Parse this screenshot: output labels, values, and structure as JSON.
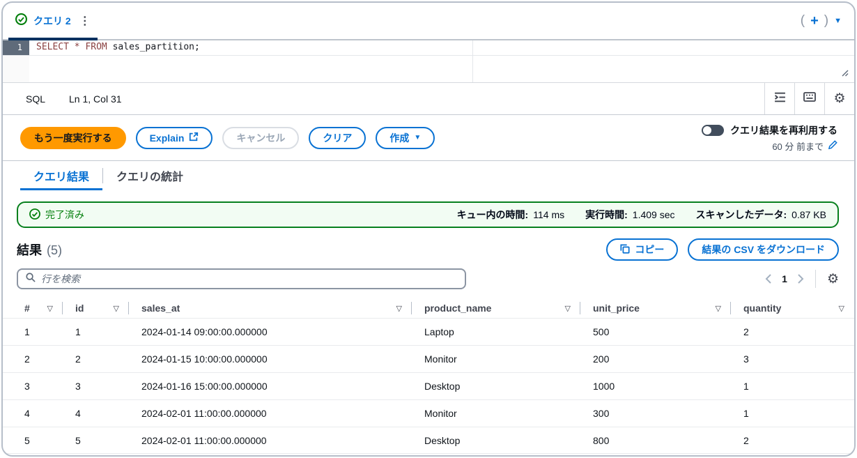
{
  "colors": {
    "accent": "#0972d3",
    "success": "#037f0c",
    "primary_button": "#ff9900",
    "active_tab_underline": "#033160"
  },
  "query_tab": {
    "label": "クエリ 2",
    "kebab_glyph": "⋮",
    "paren_open": "(",
    "plus_glyph": "+",
    "paren_close": ")",
    "caret_glyph": "▼"
  },
  "editor": {
    "line_number": "1",
    "kw_select": "SELECT",
    "star": "*",
    "kw_from": "FROM",
    "identifier": "sales_partition;"
  },
  "status_bar": {
    "language": "SQL",
    "cursor_position": "Ln 1, Col 31"
  },
  "actions": {
    "run_again": "もう一度実行する",
    "explain": "Explain",
    "cancel": "キャンセル",
    "clear": "クリア",
    "create": "作成",
    "create_caret": "▼",
    "reuse_toggle_label": "クエリ結果を再利用する",
    "reuse_duration": "60 分 前まで"
  },
  "result_tabs": {
    "results": "クエリ結果",
    "statistics": "クエリの統計"
  },
  "status_banner": {
    "status": "完了済み",
    "queue_time_label": "キュー内の時間:",
    "queue_time_value": "114 ms",
    "run_time_label": "実行時間:",
    "run_time_value": "1.409 sec",
    "data_scanned_label": "スキャンしたデータ:",
    "data_scanned_value": "0.87 KB"
  },
  "results_section": {
    "title": "結果",
    "count": "(5)",
    "copy_button": "コピー",
    "download_button": "結果の CSV をダウンロード",
    "search_placeholder": "行を検索",
    "page_number": "1"
  },
  "table": {
    "filter_glyph": "▽",
    "columns": [
      "#",
      "id",
      "sales_at",
      "product_name",
      "unit_price",
      "quantity"
    ],
    "rows": [
      [
        "1",
        "1",
        "2024-01-14 09:00:00.000000",
        "Laptop",
        "500",
        "2"
      ],
      [
        "2",
        "2",
        "2024-01-15 10:00:00.000000",
        "Monitor",
        "200",
        "3"
      ],
      [
        "3",
        "3",
        "2024-01-16 15:00:00.000000",
        "Desktop",
        "1000",
        "1"
      ],
      [
        "4",
        "4",
        "2024-02-01 11:00:00.000000",
        "Monitor",
        "300",
        "1"
      ],
      [
        "5",
        "5",
        "2024-02-01 11:00:00.000000",
        "Desktop",
        "800",
        "2"
      ]
    ]
  }
}
